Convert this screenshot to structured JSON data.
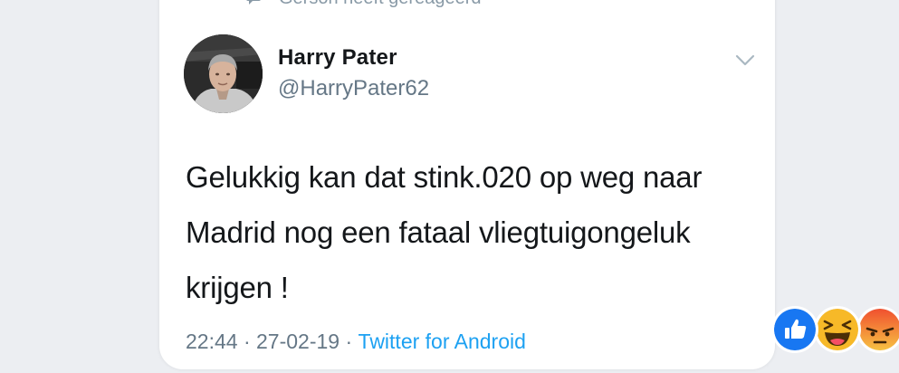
{
  "social_context": {
    "text": "Gerson heeft gereageerd",
    "icon": "speech-bubble-icon"
  },
  "tweet": {
    "author_name": "Harry Pater",
    "author_handle": "@HarryPater62",
    "avatar": "avatar-photo",
    "menu_icon": "chevron-down-icon",
    "text": "Gelukkig kan dat stink.020 op weg naar Madrid nog een fataal vliegtuigongeluk krijgen !",
    "time": "22:44",
    "separator_1": " · ",
    "date": "27-02-19",
    "separator_2": " · ",
    "source": "Twitter for Android"
  },
  "reactions": [
    {
      "name": "like",
      "icon": "like-reaction-icon",
      "color": "#1877f2"
    },
    {
      "name": "haha",
      "icon": "haha-reaction-icon",
      "color": "#f7b928"
    },
    {
      "name": "angry",
      "icon": "angry-reaction-icon",
      "color": "#e9710f"
    }
  ],
  "colors": {
    "background": "#eceef2",
    "card": "#ffffff",
    "text": "#14171a",
    "secondary": "#657786",
    "link": "#1da1f2"
  }
}
